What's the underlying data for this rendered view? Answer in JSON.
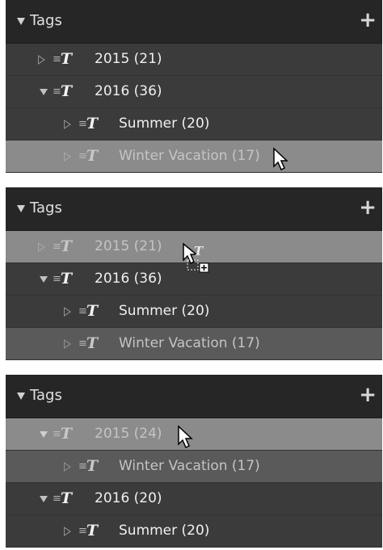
{
  "panels": [
    {
      "header": {
        "title": "Tags",
        "add_label": "+"
      },
      "rows": [
        {
          "label": "2015 (21)",
          "state": "collapsed"
        },
        {
          "label": "2016 (36)",
          "state": "expanded"
        },
        {
          "label": "Summer (20)",
          "state": "collapsed"
        },
        {
          "label": "Winter Vacation (17)",
          "state": "collapsed"
        }
      ]
    },
    {
      "header": {
        "title": "Tags",
        "add_label": "+"
      },
      "rows": [
        {
          "label": "2015 (21)",
          "state": "collapsed"
        },
        {
          "label": "2016 (36)",
          "state": "expanded"
        },
        {
          "label": "Summer (20)",
          "state": "collapsed"
        },
        {
          "label": "Winter Vacation (17)",
          "state": "collapsed"
        }
      ],
      "drag_ghost_icon": "T"
    },
    {
      "header": {
        "title": "Tags",
        "add_label": "+"
      },
      "rows": [
        {
          "label": "2015 (24)",
          "state": "expanded"
        },
        {
          "label": "Winter Vacation (17)",
          "state": "collapsed"
        },
        {
          "label": "2016 (20)",
          "state": "expanded"
        },
        {
          "label": "Summer (20)",
          "state": "collapsed"
        }
      ]
    }
  ],
  "icons": {
    "tag": "T",
    "tag_lines": "≡"
  },
  "colors": {
    "panel_bg": "#3b3b3b",
    "header_bg": "#262626",
    "highlight_bg": "#8b8b8b",
    "selected_bg": "#5a5a5a"
  }
}
